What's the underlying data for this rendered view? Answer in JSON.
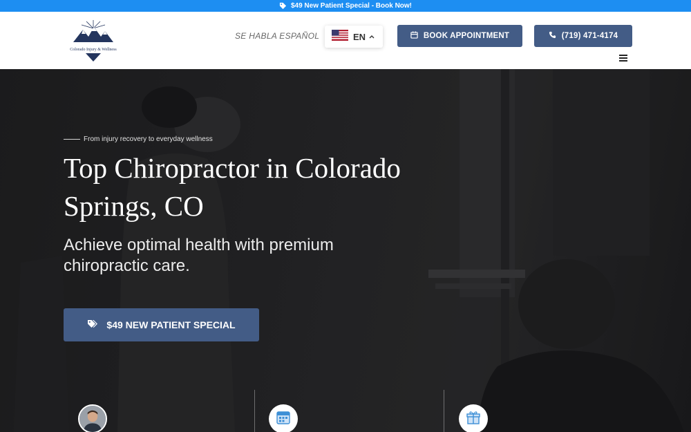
{
  "promo_bar": {
    "text": "$49 New Patient Special - Book Now!",
    "icon": "tag-icon"
  },
  "header": {
    "logo": {
      "text": "Colorado Injury & Wellness",
      "icon": "mountain-logo"
    },
    "habla": "SE HABLA ESPAÑOL",
    "language": {
      "code": "EN",
      "flag": "us-flag-icon",
      "icon": "chevron-up-icon"
    },
    "book_button": {
      "label": "BOOK APPOINTMENT",
      "icon": "calendar-icon"
    },
    "phone_button": {
      "label": "(719) 471-4174",
      "icon": "phone-icon"
    },
    "menu_icon": "hamburger-icon"
  },
  "hero": {
    "eyebrow": "From injury recovery to everyday wellness",
    "title": "Top Chiropractor in Colorado Springs, CO",
    "subtitle": "Achieve optimal health with premium chiropractic care.",
    "cta": {
      "label": "$49 NEW PATIENT SPECIAL",
      "icon": "tags-icon"
    }
  },
  "features": [
    {
      "icon": "doctor-avatar"
    },
    {
      "icon": "calendar-icon"
    },
    {
      "icon": "gift-icon"
    }
  ],
  "colors": {
    "promo_bg": "#1d8ef2",
    "button_bg": "#435c86",
    "hero_bg": "#1e1e20",
    "logo_navy": "#24355e"
  }
}
